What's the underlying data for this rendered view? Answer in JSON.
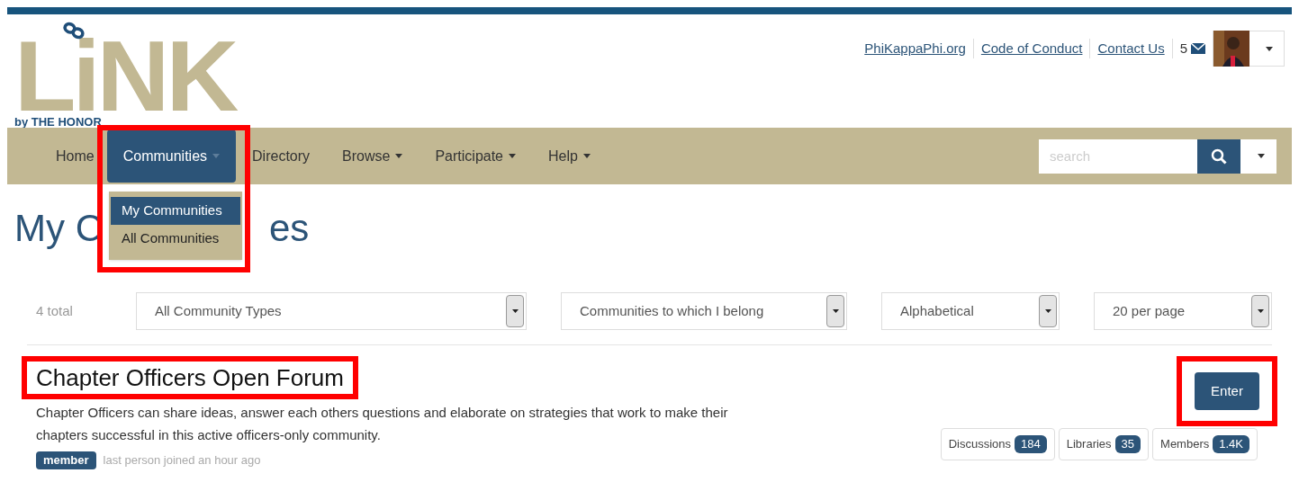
{
  "logo": {
    "wordmark": "LiNK",
    "tagline": "by THE HONOR"
  },
  "top_links": [
    {
      "label": "PhiKappaPhi.org"
    },
    {
      "label": "Code of Conduct"
    },
    {
      "label": "Contact Us"
    }
  ],
  "messages": {
    "count": "5"
  },
  "nav": [
    {
      "label": "Home",
      "selected": false,
      "caret": false
    },
    {
      "label": "Communities",
      "selected": true,
      "caret": true
    },
    {
      "label": "Directory",
      "selected": false,
      "caret": false
    },
    {
      "label": "Browse",
      "selected": false,
      "caret": true
    },
    {
      "label": "Participate",
      "selected": false,
      "caret": true
    },
    {
      "label": "Help",
      "selected": false,
      "caret": true
    }
  ],
  "dropdown": {
    "highlighted": true,
    "items": [
      {
        "label": "My Communities",
        "selected": true
      },
      {
        "label": "All Communities",
        "selected": false
      }
    ]
  },
  "search": {
    "placeholder": "search"
  },
  "page_title": [
    "My C",
    "es"
  ],
  "total": "4 total",
  "filters": [
    {
      "value": "All Community Types"
    },
    {
      "value": "Communities to which I belong"
    },
    {
      "value": "Alphabetical"
    },
    {
      "value": "20 per page"
    }
  ],
  "community": {
    "title": "Chapter Officers Open Forum",
    "title_highlighted": true,
    "description": "Chapter Officers can share ideas, answer each others questions and elaborate on strategies that work to make their chapters successful in this active officers-only community.",
    "button": "Enter",
    "button_highlighted": true,
    "badge": "member",
    "activity": "last person joined an hour ago",
    "stats": [
      {
        "label": "Discussions",
        "count": "184"
      },
      {
        "label": "Libraries",
        "count": "35"
      },
      {
        "label": "Members",
        "count": "1.4K"
      }
    ]
  }
}
